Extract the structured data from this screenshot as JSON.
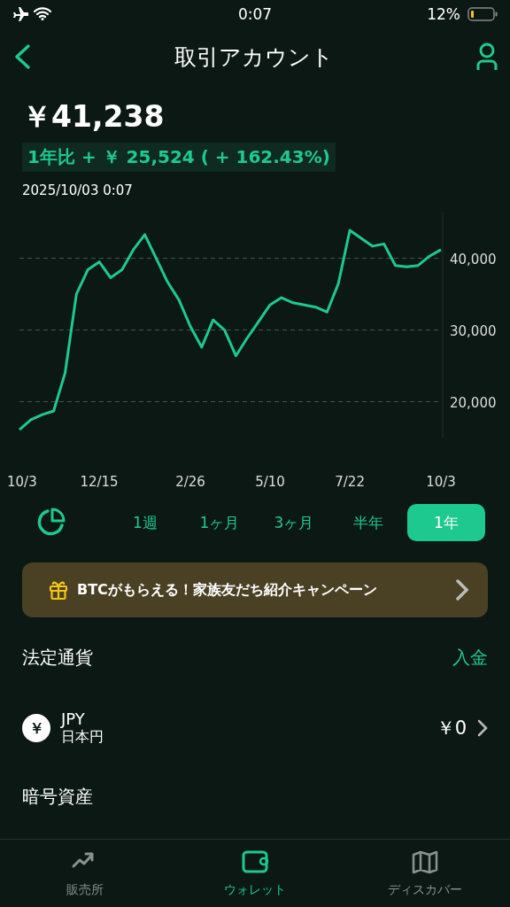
{
  "status_bar": {
    "time": "0:07",
    "battery": "12%"
  },
  "header": {
    "title": "取引アカウント"
  },
  "summary": {
    "amount": "￥41,238",
    "change": "1年比 + ￥ 25,524 ( + 162.43%)",
    "timestamp": "2025/10/03 0:07"
  },
  "chart_data": {
    "type": "line",
    "grid": true,
    "ylim": [
      15000,
      46500
    ],
    "categories": [
      "10/3",
      null,
      null,
      null,
      null,
      null,
      null,
      "12/15",
      null,
      null,
      null,
      null,
      null,
      null,
      null,
      "2/26",
      null,
      null,
      null,
      null,
      null,
      null,
      "5/10",
      null,
      null,
      null,
      null,
      null,
      null,
      "7/22",
      null,
      null,
      null,
      null,
      null,
      null,
      null,
      "10/3"
    ],
    "yticks": [
      {
        "value": 20000,
        "label": "20,000"
      },
      {
        "value": 30000,
        "label": "30,000"
      },
      {
        "value": 40000,
        "label": "40,000"
      }
    ],
    "series": [
      {
        "color": "#1ec98f",
        "values": [
          16100,
          17500,
          18200,
          18700,
          24000,
          35000,
          38400,
          39500,
          37300,
          38400,
          41200,
          43300,
          40000,
          36700,
          34200,
          30500,
          27600,
          31400,
          30000,
          26400,
          28900,
          31200,
          33500,
          34500,
          33800,
          33500,
          33200,
          32500,
          36500,
          43900,
          42800,
          41700,
          42000,
          39000,
          38800,
          39000,
          40300,
          41200
        ]
      }
    ]
  },
  "periods": [
    {
      "label": "1週",
      "selected": false
    },
    {
      "label": "1ヶ月",
      "selected": false
    },
    {
      "label": "3ヶ月",
      "selected": false
    },
    {
      "label": "半年",
      "selected": false
    },
    {
      "label": "1年",
      "selected": true
    }
  ],
  "banner": {
    "text": "BTCがもらえる！家族友だち紹介キャンペーン"
  },
  "fiat": {
    "title": "法定通貨",
    "action": "入金",
    "items": [
      {
        "symbol": "￥",
        "code": "JPY",
        "name": "日本円",
        "balance": "￥0"
      }
    ]
  },
  "crypto": {
    "title": "暗号資産"
  },
  "tabs": [
    {
      "label": "販売所",
      "kind": "trend",
      "selected": false
    },
    {
      "label": "ウォレット",
      "kind": "wallet",
      "selected": true
    },
    {
      "label": "ディスカバー",
      "kind": "map",
      "selected": false
    }
  ]
}
